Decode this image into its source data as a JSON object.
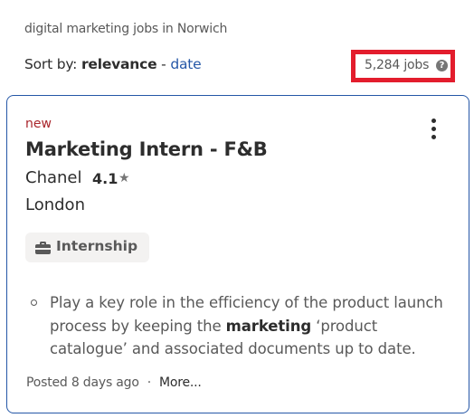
{
  "search": {
    "query_label": "digital marketing jobs in Norwich"
  },
  "sort": {
    "prefix": "Sort by:",
    "active": "relevance",
    "separator": "-",
    "alternative": "date"
  },
  "results": {
    "count": "5,284 jobs",
    "help_icon": "question-circle-icon"
  },
  "job": {
    "badge": "new",
    "title": "Marketing Intern - F&B",
    "company": "Chanel",
    "rating": "4.1",
    "rating_icon": "star-icon",
    "location": "London",
    "job_type": "Internship",
    "job_type_icon": "briefcase-icon",
    "snippet": {
      "before": "Play a key role in the efficiency of the product launch process by keeping the ",
      "highlight": "marketing",
      "after": " ‘product catalogue’ and associated documents up to date."
    },
    "posted": "Posted 8 days ago",
    "footer_separator": "·",
    "more_label": "More..."
  },
  "colors": {
    "highlight_border": "#e31d2d",
    "card_border": "#2557a7",
    "link": "#2557a7",
    "new_badge": "#a9252b"
  }
}
